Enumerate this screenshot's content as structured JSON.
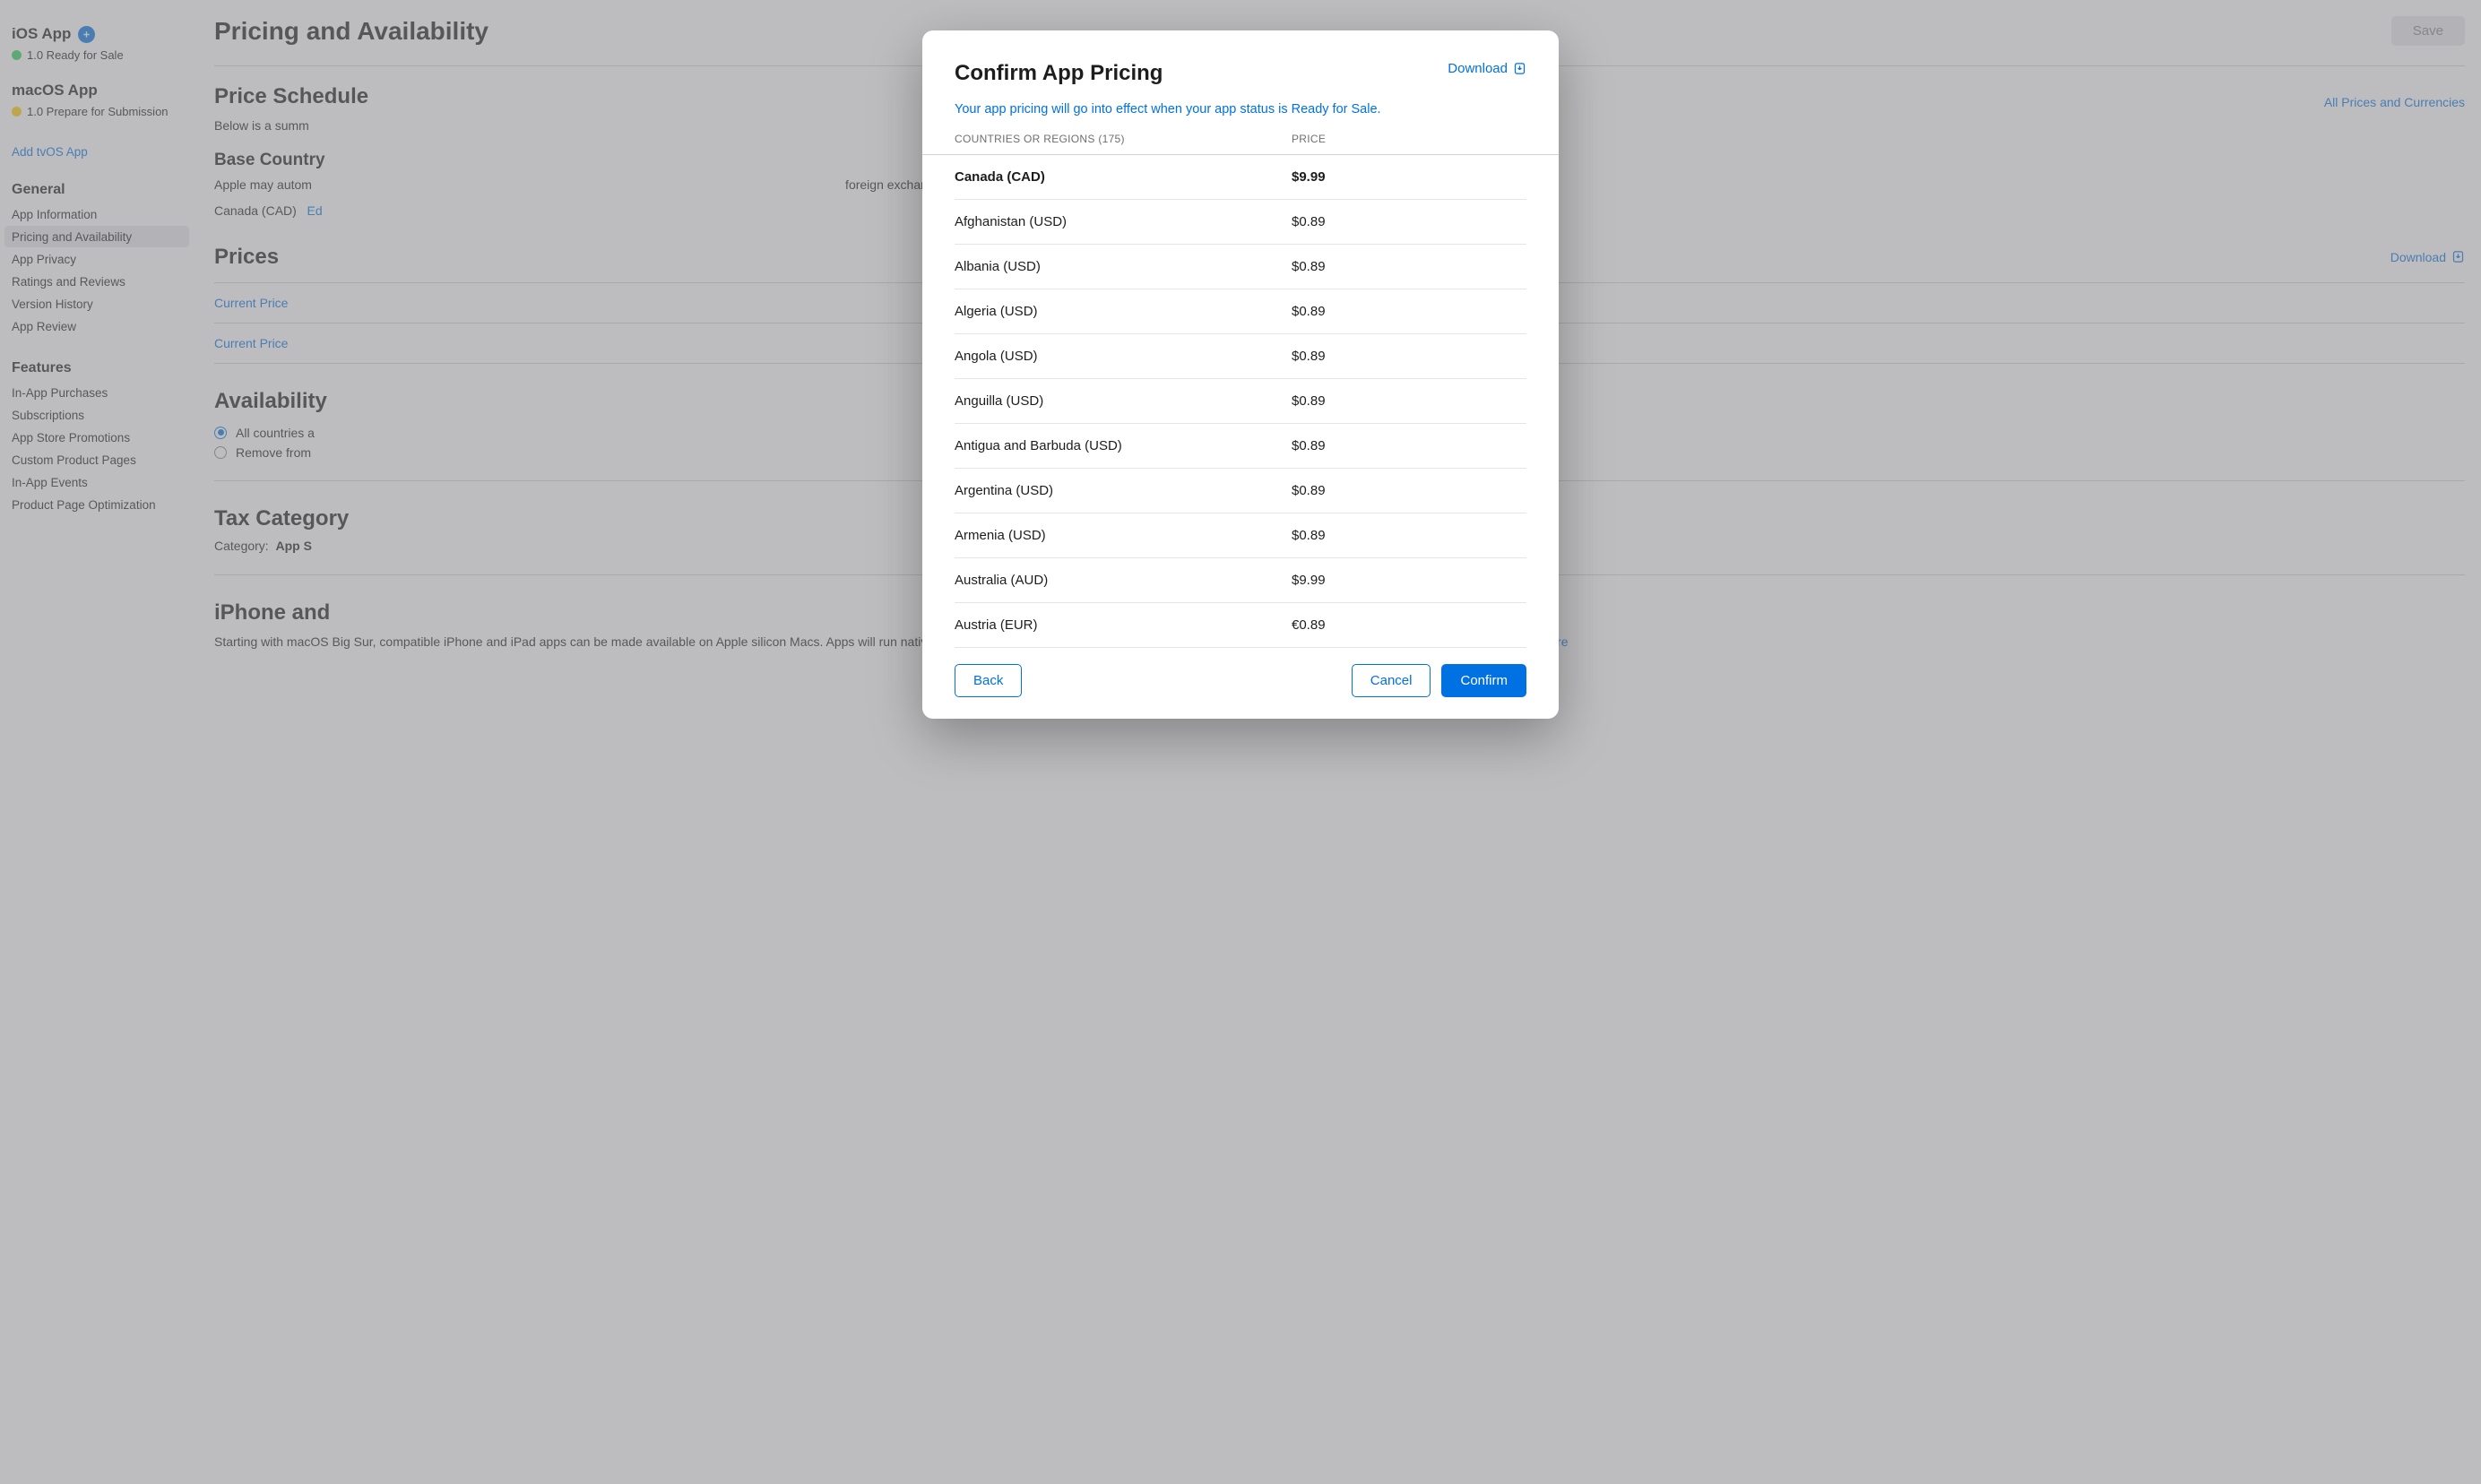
{
  "sidebar": {
    "platforms": [
      {
        "title": "iOS App",
        "status": "1.0 Ready for Sale",
        "dot": "green",
        "hasAdd": true
      },
      {
        "title": "macOS App",
        "status": "1.0 Prepare for Submission",
        "dot": "yellow",
        "hasAdd": false
      }
    ],
    "addPlatform": "Add tvOS App",
    "sections": [
      {
        "heading": "General",
        "items": [
          {
            "label": "App Information",
            "active": false
          },
          {
            "label": "Pricing and Availability",
            "active": true
          },
          {
            "label": "App Privacy",
            "active": false
          },
          {
            "label": "Ratings and Reviews",
            "active": false
          },
          {
            "label": "Version History",
            "active": false
          },
          {
            "label": "App Review",
            "active": false
          }
        ]
      },
      {
        "heading": "Features",
        "items": [
          {
            "label": "In-App Purchases"
          },
          {
            "label": "Subscriptions"
          },
          {
            "label": "App Store Promotions"
          },
          {
            "label": "Custom Product Pages"
          },
          {
            "label": "In-App Events"
          },
          {
            "label": "Product Page Optimization"
          }
        ]
      }
    ]
  },
  "page": {
    "title": "Pricing and Availability",
    "saveLabel": "Save",
    "priceScheduleHeading": "Price Schedule",
    "allPricesLink": "All Prices and Currencies",
    "summaryText": "Below is a summ",
    "baseCountryHeading": "Base Country",
    "baseCountryBody": "Apple may autom                                                                                                                                                         foreign exchange rates.",
    "baseCountryValue": "Canada (CAD)",
    "editLabel": "Ed",
    "pricesHeading": "Prices",
    "downloadLabel": "Download",
    "currentPriceLabel": "Current Price",
    "availabilityHeading": "Availability",
    "availabilityOptions": [
      "All countries a",
      "Remove from"
    ],
    "taxHeading": "Tax Category",
    "taxCategoryLabel": "Category:",
    "taxCategoryValue": "App S",
    "iphoneHeading": "iPhone and",
    "iphoneBody": "Starting with macOS Big Sur, compatible iPhone and iPad apps can be made available on Apple silicon Macs. Apps will run natively and use the same frameworks, resources, and runtime environment as they do on iOS and iPadOS.",
    "learnMore": "Learn More"
  },
  "modal": {
    "title": "Confirm App Pricing",
    "downloadLabel": "Download",
    "description": "Your app pricing will go into effect when your app status is Ready for Sale.",
    "header": {
      "countries": "COUNTRIES OR REGIONS (175)",
      "price": "PRICE"
    },
    "rows": [
      {
        "country": "Canada (CAD)",
        "price": "$9.99",
        "base": true
      },
      {
        "country": "Afghanistan (USD)",
        "price": "$0.89"
      },
      {
        "country": "Albania (USD)",
        "price": "$0.89"
      },
      {
        "country": "Algeria (USD)",
        "price": "$0.89"
      },
      {
        "country": "Angola (USD)",
        "price": "$0.89"
      },
      {
        "country": "Anguilla (USD)",
        "price": "$0.89"
      },
      {
        "country": "Antigua and Barbuda (USD)",
        "price": "$0.89"
      },
      {
        "country": "Argentina (USD)",
        "price": "$0.89"
      },
      {
        "country": "Armenia (USD)",
        "price": "$0.89"
      },
      {
        "country": "Australia (AUD)",
        "price": "$9.99"
      },
      {
        "country": "Austria (EUR)",
        "price": "€0.89"
      }
    ],
    "backLabel": "Back",
    "cancelLabel": "Cancel",
    "confirmLabel": "Confirm"
  }
}
